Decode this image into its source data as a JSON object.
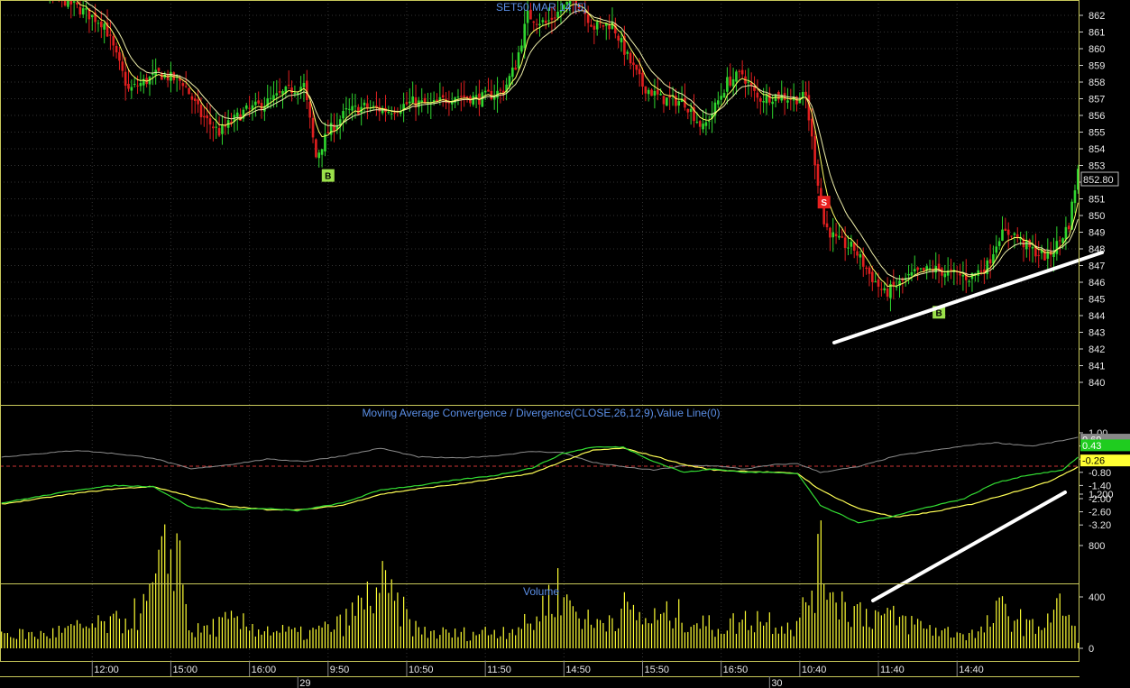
{
  "colors": {
    "background": "#000000",
    "up_candle": "#2fd62f",
    "down_candle": "#e01f1f",
    "ma_fast": "#ffff66",
    "ma_slow": "#eeeeaa",
    "macd_line": "#33dd33",
    "signal_line": "#ffff55",
    "value_line": "#8c8c8c",
    "zero_line": "#cc3333",
    "volume_bar": "#ffff33",
    "panel_border": "#c8c85a",
    "grid": "#333333",
    "buy_marker": "#9be04a",
    "sell_marker": "#e8201f",
    "trendline": "#ffffff"
  },
  "chart_data": [
    {
      "type": "candlestick",
      "title": "SET50 MAR 14 [5]",
      "ylim": [
        839,
        863
      ],
      "yticks": [
        "862",
        "861",
        "860",
        "859",
        "858",
        "857",
        "856",
        "855",
        "854",
        "853",
        "852",
        "851",
        "850",
        "849",
        "848",
        "847",
        "846",
        "845",
        "844",
        "843",
        "842",
        "841",
        "840"
      ],
      "last_price": "852.80",
      "price_path": [
        [
          0,
          866.0
        ],
        [
          8,
          864.0
        ],
        [
          20,
          863.0
        ],
        [
          34,
          861.5
        ],
        [
          42,
          857.5
        ],
        [
          52,
          858.5
        ],
        [
          60,
          858.0
        ],
        [
          66,
          856.0
        ],
        [
          72,
          855.0
        ],
        [
          80,
          856.2
        ],
        [
          88,
          856.8
        ],
        [
          95,
          857.5
        ],
        [
          100,
          857.8
        ],
        [
          104,
          853.5
        ],
        [
          108,
          855.0
        ],
        [
          114,
          856.2
        ],
        [
          120,
          856.5
        ],
        [
          128,
          856.3
        ],
        [
          136,
          856.8
        ],
        [
          142,
          856.6
        ],
        [
          150,
          857.2
        ],
        [
          158,
          857.0
        ],
        [
          166,
          857.5
        ],
        [
          170,
          859.0
        ],
        [
          174,
          862.0
        ],
        [
          180,
          861.5
        ],
        [
          186,
          862.5
        ],
        [
          190,
          863.0
        ],
        [
          196,
          861.3
        ],
        [
          202,
          861.5
        ],
        [
          207,
          859.5
        ],
        [
          212,
          857.8
        ],
        [
          218,
          857.0
        ],
        [
          226,
          856.8
        ],
        [
          232,
          855.2
        ],
        [
          236,
          856.5
        ],
        [
          240,
          858.0
        ],
        [
          245,
          858.5
        ],
        [
          250,
          857.0
        ],
        [
          256,
          857.2
        ],
        [
          262,
          857.0
        ],
        [
          266,
          857.1
        ],
        [
          272,
          849.5
        ],
        [
          276,
          848.5
        ],
        [
          282,
          848.0
        ],
        [
          287,
          846.5
        ],
        [
          292,
          845.3
        ],
        [
          296,
          845.8
        ],
        [
          302,
          846.5
        ],
        [
          308,
          846.8
        ],
        [
          314,
          846.5
        ],
        [
          320,
          846.3
        ],
        [
          326,
          847.0
        ],
        [
          330,
          848.8
        ],
        [
          334,
          849.0
        ],
        [
          340,
          848.0
        ],
        [
          346,
          847.5
        ],
        [
          350,
          848.5
        ],
        [
          353,
          849.5
        ],
        [
          356,
          852.8
        ]
      ],
      "signals": [
        {
          "type": "B",
          "price": 852.4
        },
        {
          "type": "S",
          "price": 850.8
        },
        {
          "type": "B",
          "price": 844.2
        }
      ]
    },
    {
      "type": "line",
      "title": "Moving Average Convergence / Divergence(CLOSE,26,12,9),Value Line(0)",
      "ylim": [
        -3.6,
        1.7
      ],
      "yticks": [
        "1.00",
        "0.40",
        "-0.20",
        "-0.80",
        "-1.40",
        "-2.00",
        "-2.60",
        "-3.20"
      ],
      "macd_path": [
        [
          0,
          -2.2
        ],
        [
          10,
          -1.9
        ],
        [
          20,
          -1.6
        ],
        [
          30,
          -1.4
        ],
        [
          40,
          -1.45
        ],
        [
          50,
          -2.4
        ],
        [
          60,
          -2.5
        ],
        [
          70,
          -2.45
        ],
        [
          78,
          -2.55
        ],
        [
          90,
          -2.2
        ],
        [
          100,
          -1.6
        ],
        [
          110,
          -1.4
        ],
        [
          120,
          -1.15
        ],
        [
          130,
          -0.95
        ],
        [
          140,
          -0.6
        ],
        [
          148,
          0.05
        ],
        [
          156,
          0.35
        ],
        [
          164,
          0.35
        ],
        [
          172,
          -0.3
        ],
        [
          180,
          -0.8
        ],
        [
          188,
          -0.65
        ],
        [
          196,
          -0.8
        ],
        [
          204,
          -0.8
        ],
        [
          210,
          -0.85
        ],
        [
          216,
          -2.3
        ],
        [
          226,
          -3.1
        ],
        [
          234,
          -2.85
        ],
        [
          244,
          -2.4
        ],
        [
          254,
          -2.0
        ],
        [
          262,
          -1.3
        ],
        [
          270,
          -0.95
        ],
        [
          280,
          -0.7
        ],
        [
          284,
          -0.1
        ]
      ],
      "signal_path": [
        [
          0,
          -2.25
        ],
        [
          10,
          -2.0
        ],
        [
          20,
          -1.75
        ],
        [
          30,
          -1.55
        ],
        [
          40,
          -1.45
        ],
        [
          50,
          -1.9
        ],
        [
          60,
          -2.35
        ],
        [
          70,
          -2.5
        ],
        [
          80,
          -2.5
        ],
        [
          90,
          -2.3
        ],
        [
          100,
          -1.8
        ],
        [
          110,
          -1.55
        ],
        [
          120,
          -1.35
        ],
        [
          130,
          -1.1
        ],
        [
          140,
          -0.85
        ],
        [
          148,
          -0.3
        ],
        [
          156,
          0.2
        ],
        [
          164,
          0.3
        ],
        [
          172,
          -0.05
        ],
        [
          180,
          -0.45
        ],
        [
          188,
          -0.7
        ],
        [
          196,
          -0.75
        ],
        [
          204,
          -0.8
        ],
        [
          210,
          -0.85
        ],
        [
          216,
          -1.6
        ],
        [
          226,
          -2.45
        ],
        [
          236,
          -2.85
        ],
        [
          246,
          -2.6
        ],
        [
          256,
          -2.25
        ],
        [
          266,
          -1.75
        ],
        [
          276,
          -1.25
        ],
        [
          284,
          -0.55
        ]
      ],
      "value_path": [
        [
          0,
          -0.1
        ],
        [
          10,
          0.05
        ],
        [
          20,
          0.2
        ],
        [
          30,
          0.05
        ],
        [
          40,
          -0.15
        ],
        [
          50,
          -0.65
        ],
        [
          60,
          -0.45
        ],
        [
          70,
          -0.2
        ],
        [
          80,
          -0.3
        ],
        [
          90,
          -0.05
        ],
        [
          100,
          0.3
        ],
        [
          110,
          -0.1
        ],
        [
          120,
          -0.15
        ],
        [
          130,
          -0.05
        ],
        [
          140,
          0.15
        ],
        [
          148,
          0.1
        ],
        [
          156,
          -0.35
        ],
        [
          164,
          -0.55
        ],
        [
          172,
          -0.7
        ],
        [
          180,
          -0.5
        ],
        [
          188,
          -0.5
        ],
        [
          196,
          -0.65
        ],
        [
          204,
          -0.45
        ],
        [
          210,
          -0.4
        ],
        [
          216,
          -0.8
        ],
        [
          226,
          -0.55
        ],
        [
          236,
          -0.05
        ],
        [
          246,
          0.2
        ],
        [
          256,
          0.45
        ],
        [
          262,
          0.55
        ],
        [
          272,
          0.4
        ],
        [
          284,
          0.78
        ]
      ],
      "tags": [
        {
          "value": 0.69,
          "label": "0.69",
          "bg": "#888888",
          "fg": "#ffffff"
        },
        {
          "value": 0.43,
          "label": "0.43",
          "bg": "#1fcc1f",
          "fg": "#ffffff"
        },
        {
          "value": -0.26,
          "label": "-0.26",
          "bg": "#ffff33",
          "fg": "#000000"
        }
      ]
    },
    {
      "type": "bar",
      "title": "Volume",
      "ylim": [
        0,
        1500
      ],
      "yticks": [
        "1,200",
        "800",
        "400",
        "0"
      ],
      "volume_path": [
        [
          0,
          160
        ],
        [
          10,
          140
        ],
        [
          20,
          210
        ],
        [
          30,
          260
        ],
        [
          38,
          420
        ],
        [
          46,
          1200
        ],
        [
          50,
          160
        ],
        [
          60,
          280
        ],
        [
          70,
          200
        ],
        [
          80,
          150
        ],
        [
          90,
          260
        ],
        [
          100,
          660
        ],
        [
          110,
          180
        ],
        [
          120,
          150
        ],
        [
          130,
          180
        ],
        [
          140,
          260
        ],
        [
          146,
          640
        ],
        [
          156,
          240
        ],
        [
          164,
          420
        ],
        [
          170,
          300
        ],
        [
          178,
          360
        ],
        [
          188,
          220
        ],
        [
          200,
          330
        ],
        [
          210,
          230
        ],
        [
          216,
          920
        ],
        [
          222,
          470
        ],
        [
          228,
          380
        ],
        [
          238,
          290
        ],
        [
          248,
          180
        ],
        [
          258,
          150
        ],
        [
          264,
          420
        ],
        [
          272,
          210
        ],
        [
          280,
          450
        ],
        [
          284,
          100
        ]
      ]
    }
  ],
  "x_axis": {
    "time_labels": [
      "12:00",
      "15:00",
      "16:00",
      "9:50",
      "10:50",
      "11:50",
      "14:50",
      "15:50",
      "16:50",
      "10:40",
      "11:40",
      "14:40"
    ],
    "date_labels": [
      "29",
      "30"
    ]
  }
}
